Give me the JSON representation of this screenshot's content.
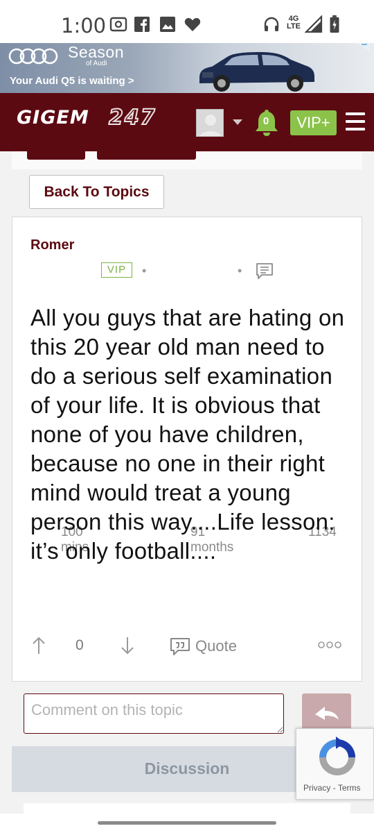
{
  "status_bar": {
    "time": "1:00",
    "network": "4G",
    "network_sub": "LTE",
    "icons": [
      "radio-icon",
      "facebook-icon",
      "gallery-icon",
      "heart-icon",
      "headphones-icon",
      "signal-icon",
      "battery-icon"
    ]
  },
  "ad": {
    "brand": "Season",
    "brand_sub": "of Audi",
    "cta": "Your Audi Q5 is waiting >"
  },
  "header": {
    "logo_text": "GIGEM",
    "logo_suffix": "247",
    "notification_count": "0",
    "vip_label": "VIP+",
    "accent_color": "#5c0a12",
    "vip_color": "#8bc34a"
  },
  "nav": {
    "back_label": "Back To Topics"
  },
  "post": {
    "author": "Romer",
    "time_ago": "100 mins",
    "badge": "VIP",
    "tenure": "91 months",
    "post_count": "1134",
    "body": "All you guys that are hating on this 20 year old man need to do a serious self examination of your life. It is obvious that none of you have children, because no one in their right mind would treat a young person this way....Life lesson: it’s only football....",
    "vote_count": "0",
    "quote_label": "Quote"
  },
  "comment": {
    "placeholder": "Comment on this topic"
  },
  "discussion": {
    "label": "Discussion"
  },
  "recaptcha": {
    "privacy": "Privacy",
    "separator": "-",
    "terms": "Terms"
  }
}
